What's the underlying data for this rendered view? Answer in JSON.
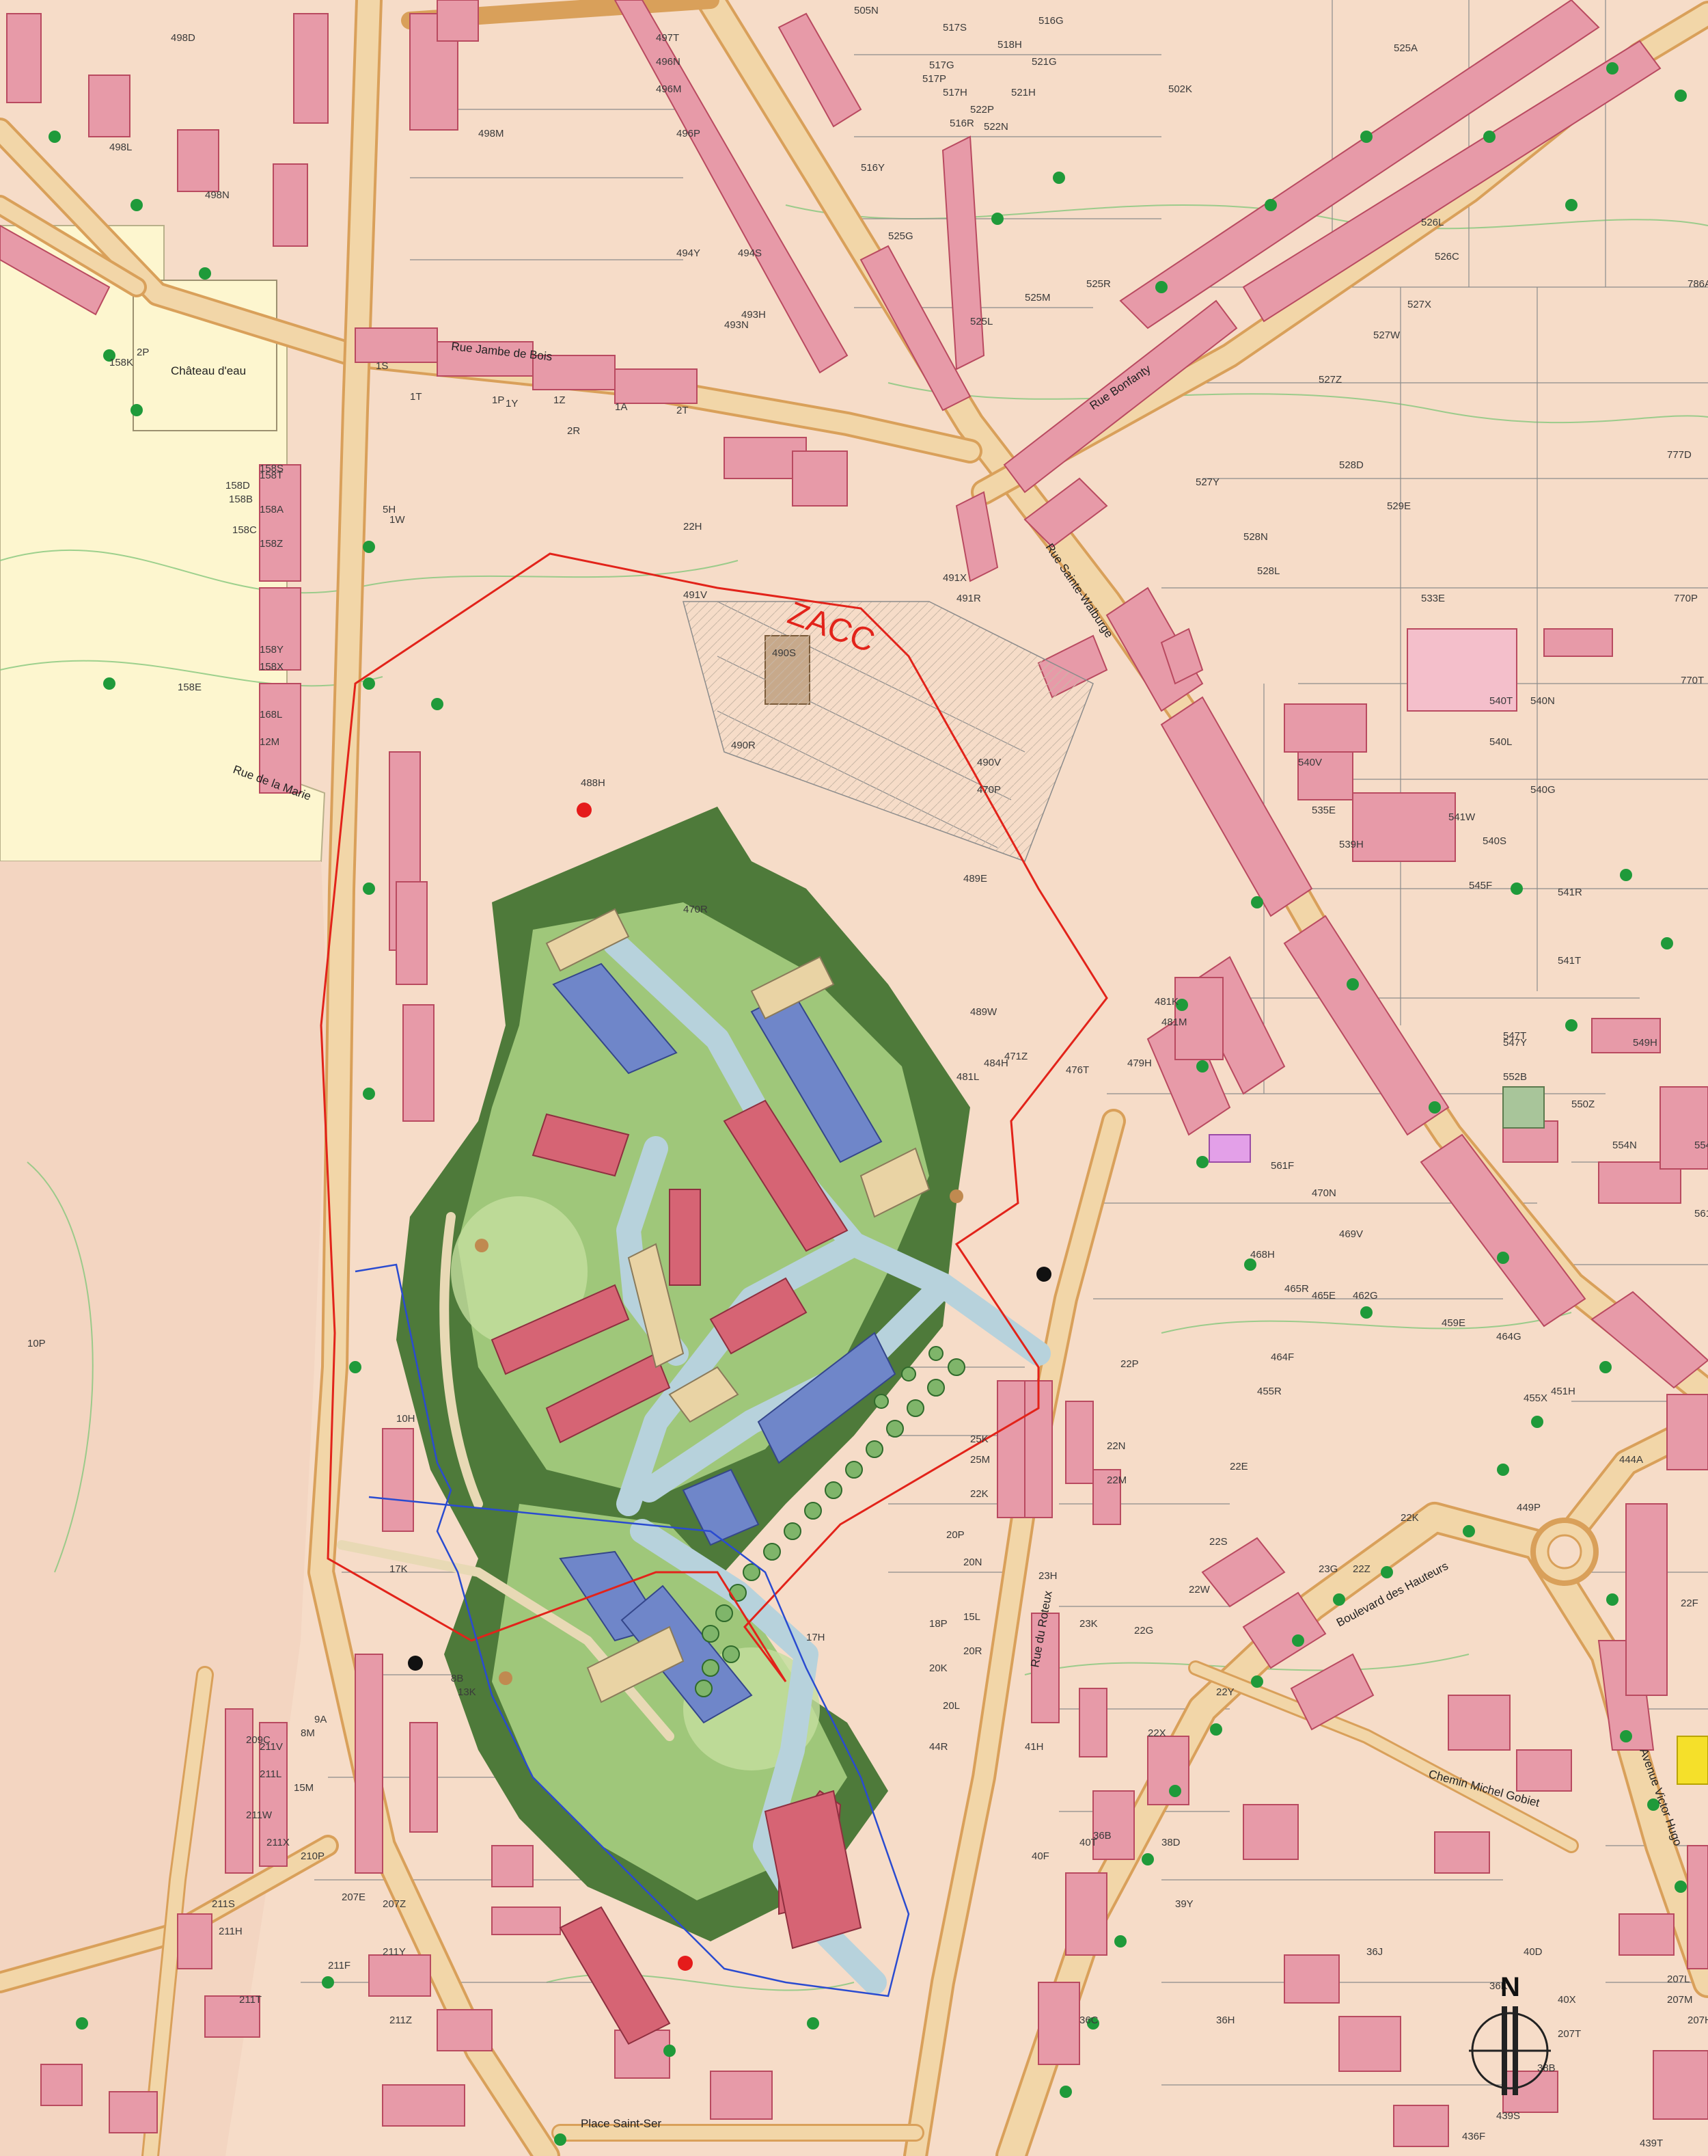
{
  "colors": {
    "background": "#f6dcc8",
    "building": "#e79aa8",
    "building_stroke": "#b94a60",
    "road": "#f2d6a8",
    "road_edge": "#d9a05a",
    "zacc_line": "#e2231a",
    "project_line": "#2a4bd0",
    "green_buffer": "#4e7a3a",
    "lawn": "#9fc77a",
    "project_building_red": "#d66474",
    "project_building_blue": "#6f86c9",
    "path": "#b7d2dc",
    "tree": "#1f9a3a",
    "contour": "#7fc77a",
    "parcel_line": "#8a8a8a"
  },
  "zone_label": "ZACC",
  "north_label": "N",
  "streets": [
    "Rue Jambe de Bois",
    "Rue Sainte-Walburge",
    "Rue Bonfanty",
    "Rue de la Marie",
    "Boulevard des Hauteurs",
    "Chemin Michel Gobiet",
    "Avenue Victor Hugo",
    "Rue du Roteux",
    "Place Saint-Ser",
    "Château d'eau"
  ],
  "parcels": [
    "498D",
    "498L",
    "498N",
    "498M",
    "497T",
    "496N",
    "496M",
    "496P",
    "494Y",
    "494S",
    "493H",
    "493N",
    "505N",
    "517S",
    "516G",
    "516R",
    "518H",
    "521G",
    "521H",
    "522P",
    "522N",
    "517G",
    "517P",
    "517H",
    "516Y",
    "525G",
    "525L",
    "525M",
    "525R",
    "525A",
    "526L",
    "526C",
    "527W",
    "527X",
    "527Z",
    "528D",
    "527Y",
    "529E",
    "528N",
    "528L",
    "533E",
    "502K",
    "786A",
    "777D",
    "770P",
    "770T",
    "540T",
    "540N",
    "540L",
    "540G",
    "541W",
    "540S",
    "540V",
    "535E",
    "539H",
    "541R",
    "541T",
    "545F",
    "547Y",
    "549H",
    "547T",
    "552B",
    "550Z",
    "554N",
    "554S",
    "561E",
    "561F",
    "470N",
    "469V",
    "468H",
    "465R",
    "465E",
    "464F",
    "462G",
    "459E",
    "464G",
    "455X",
    "455R",
    "451H",
    "449P",
    "444A",
    "22F",
    "22K",
    "22E",
    "22S",
    "23H",
    "23K",
    "23G",
    "22Z",
    "22X",
    "22Y",
    "22W",
    "22G",
    "22N",
    "22M",
    "22P",
    "22H",
    "491V",
    "491X",
    "491R",
    "490S",
    "490R",
    "490V",
    "489E",
    "489W",
    "484H",
    "481L",
    "481K",
    "481M",
    "479H",
    "476T",
    "471Z",
    "470P",
    "470R",
    "488H",
    "5H",
    "1W",
    "1S",
    "1T",
    "1P",
    "1Y",
    "1Z",
    "1A",
    "2T",
    "2R",
    "2P",
    "158K",
    "158S",
    "158T",
    "158D",
    "158B",
    "158A",
    "158C",
    "158Z",
    "158Y",
    "158X",
    "158E",
    "168L",
    "12M",
    "10P",
    "10H",
    "8B",
    "13K",
    "17K",
    "17H",
    "18P",
    "20K",
    "20L",
    "20P",
    "20N",
    "20R",
    "15L",
    "22K",
    "25M",
    "25K",
    "44R",
    "41H",
    "40T",
    "40F",
    "36C",
    "36H",
    "36B",
    "39Y",
    "40D",
    "40X",
    "38B",
    "38D",
    "36J",
    "36K",
    "436F",
    "439T",
    "439S",
    "207T",
    "207H",
    "207M",
    "207L",
    "207E",
    "207Z",
    "211Y",
    "211Z",
    "211F",
    "211H",
    "211S",
    "211T",
    "211X",
    "211W",
    "211L",
    "211V",
    "209C",
    "210P",
    "8M",
    "9A",
    "15M"
  ]
}
